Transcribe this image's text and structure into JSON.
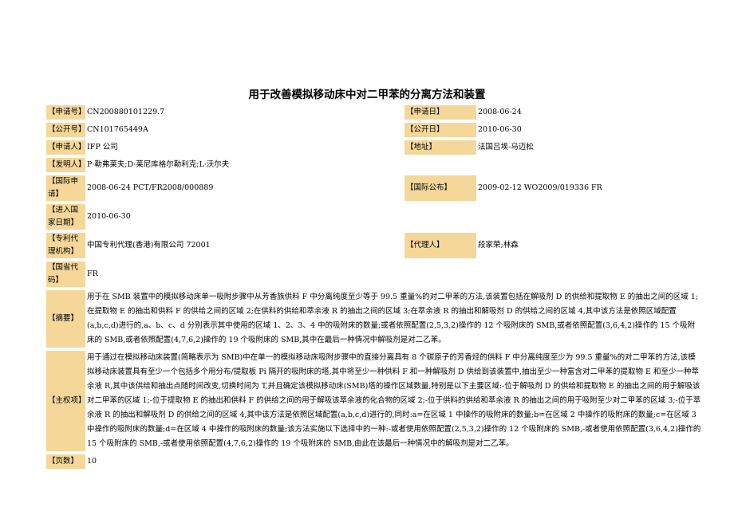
{
  "title": "用于改善模拟移动床中对二甲苯的分离方法和装置",
  "fields": {
    "app_no_label": "【申请号】",
    "app_no": "CN200880101229.7",
    "app_date_label": "【申请日】",
    "app_date": "2008-06-24",
    "pub_no_label": "【公开号】",
    "pub_no": "CN101765449A",
    "pub_date_label": "【公开日】",
    "pub_date": "2010-06-30",
    "applicant_label": "【申请人】",
    "applicant": "IFP 公司",
    "address_label": "【地址】",
    "address": "法国吕埃-马迈松",
    "inventor_label": "【发明人】",
    "inventor": "P·勒弗莱夫;D·莱尼库格尔勒利克;L·沃尔夫",
    "intl_app_label": "【国际申请】",
    "intl_app": "2008-06-24 PCT/FR2008/000889",
    "intl_pub_label": "【国际公布】",
    "intl_pub": "2009-02-12 WO2009/019336 FR",
    "nat_entry_label": "【进入国家日期】",
    "nat_entry": "2010-06-30",
    "agency_label": "【专利代理机构】",
    "agency": "中国专利代理(香港)有限公司 72001",
    "agent_label": "【代理人】",
    "agent": "段家荣;林森",
    "country_label": "【国省代码】",
    "country": "FR",
    "abstract_label": "【摘要】",
    "abstract": "用于在 SMB 装置中的模拟移动床单一吸附步骤中从芳香族供料 F 中分离纯度至少等于 99.5 重量%的对二甲苯的方法,该装置包括在解吸剂 D 的供给和提取物 E 的抽出之间的区域 1;在提取物 E 的抽出和供料 F 的供给之间的区域 2;在供料的供给和萃余液 R 的抽出之间的区域 3;在萃余液 R 的抽出和解吸剂 D 的供给之间的区域 4,其中该方法是依照区域配置(a,b,c,d)进行的,a、b、c、d 分别表示其中使用的区域 1、2、3、4 中的吸附床的数量;或者依照配置(2,5,3,2)操作的 12 个吸附床的 SMB,或者依照配置(3,6,4,2)操作的 15 个吸附床的 SMB,或者依照配置(4,7,6,2)操作的 19 个吸附床的 SMB,其中在最后一种情况中解吸剂是对二乙苯。",
    "claims_label": "【主权项】",
    "claims": "用于通过在模拟移动床装置(简略表示为 SMB)中在单一的模拟移动床吸附步骤中的直接分离具有 8 个碳原子的芳香烃的供料 F 中分离纯度至少为 99.5 重量%的对二甲苯的方法,该模拟移动床装置具有至少一个包括多个用分布/提取板 Pi 隔开的吸附床的塔,其中将至少一种供料 F 和一种解吸剂 D 供给到该装置中,抽出至少一种富含对二甲苯的提取物 E 和至少一种萃余液 R,其中该供给和抽出点随时间改变,切换时间为 T,并且确定该模拟移动床(SMB)塔的操作区域数量,特别是以下主要区域:-位于解吸剂 D 的供给和提取物 E 的抽出之间的用于解吸该对二甲苯的区域 1;-位于提取物 E 的抽出和供料 F 的供给之间的用于解吸该萃余液的化合物的区域 2;-位于供料的供给和萃余液 R 的抽出之间的用于吸附至少对二甲苯的区域 3;-位于萃余液 R 的抽出和解吸剂 D 的供给之间的区域 4,其中该方法是依照区域配置(a,b,c,d)进行的,同时:a=在区域 1 中操作的吸附床的数量;b=在区域 2 中操作的吸附床的数量;c=在区域 3 中操作的吸附床的数量;d=在区域 4 中操作的吸附床的数量;该方法实施以下选择中的一种:-或者使用依照配置(2,5,3,2)操作的 12 个吸附床的 SMB,-或者使用依照配置(3,6,4,2)操作的 15 个吸附床的 SMB,-或者使用依照配置(4,7,6,2)操作的 19 个吸附床的 SMB,由此在该最后一种情况中的解吸剂是对二乙苯。",
    "pages_label": "【页数】",
    "pages": "10"
  }
}
